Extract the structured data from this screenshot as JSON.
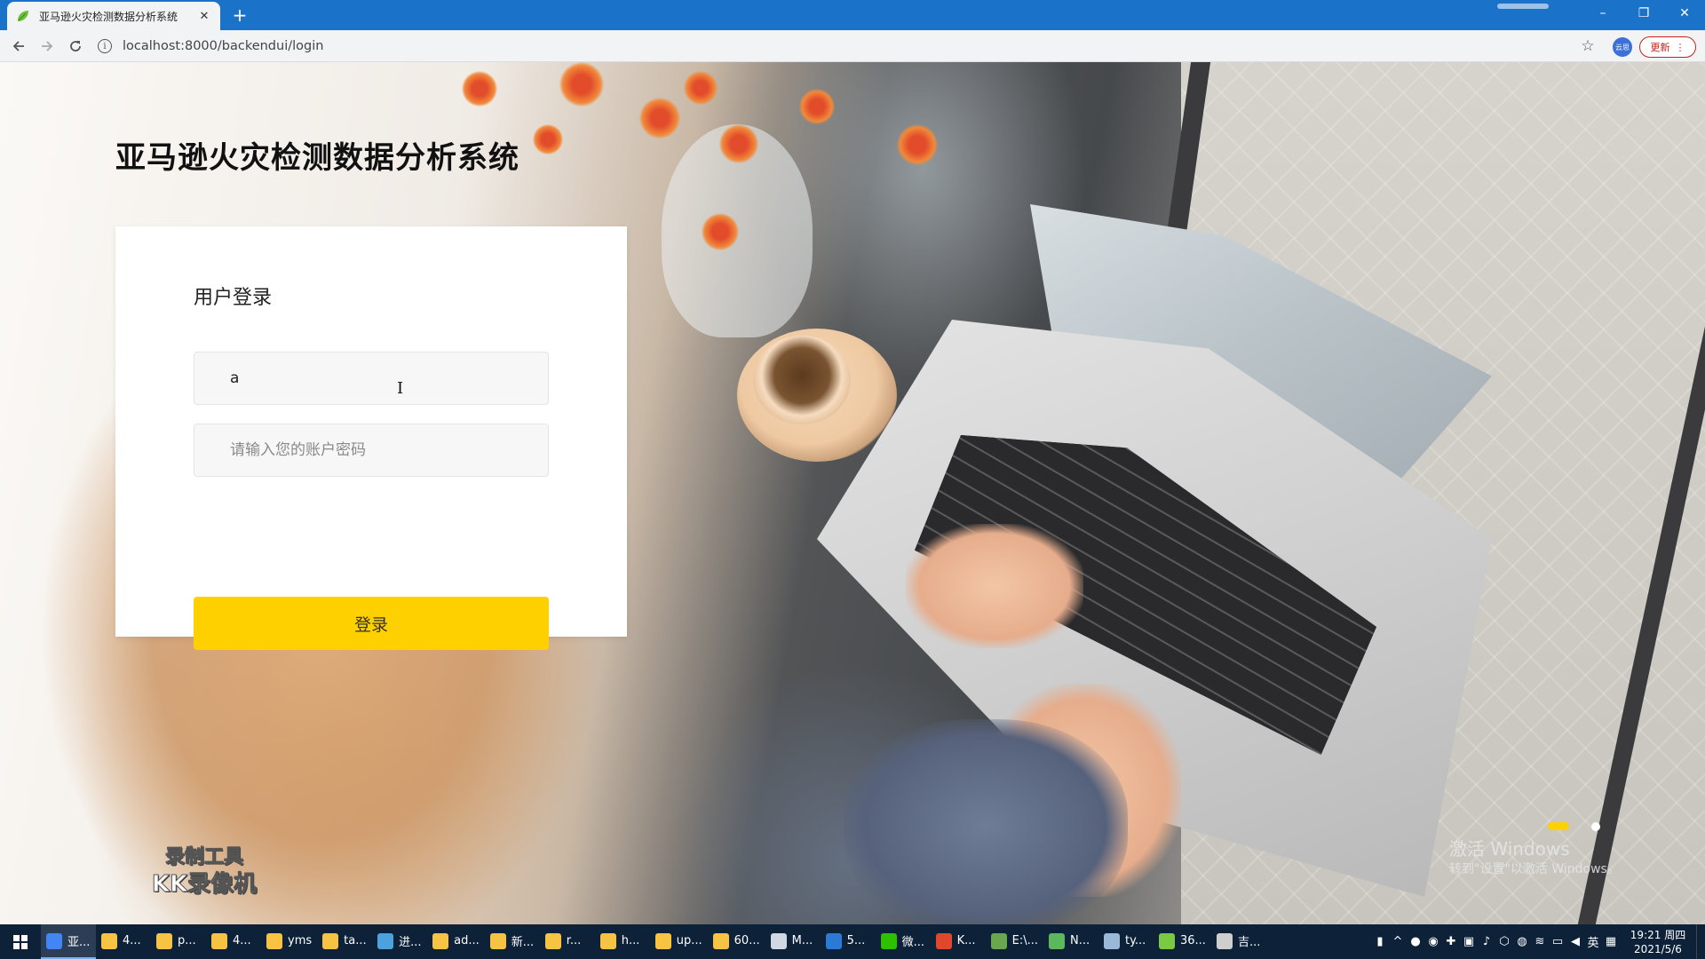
{
  "browser": {
    "tab_title": "亚马逊火灾检测数据分析系统",
    "tab_close": "✕",
    "new_tab": "+",
    "url": "localhost:8000/backendui/login",
    "profile_label": "云思",
    "update_label": "更新",
    "window_controls": {
      "minimize": "–",
      "restore": "❐",
      "close": "✕"
    }
  },
  "page": {
    "site_title": "亚马逊火灾检测数据分析系统",
    "login": {
      "title": "用户登录",
      "username_value": "a",
      "password_placeholder": "请输入您的账户密码",
      "submit_label": "登录"
    },
    "carousel": {
      "active_index": 0,
      "count": 2
    },
    "watermark": {
      "line1": "录制工具",
      "line2": "KK录像机"
    },
    "activate_windows": {
      "line1": "激活 Windows",
      "line2": "转到\"设置\"以激活 Windows。"
    }
  },
  "taskbar": {
    "items": [
      {
        "label": "亚...",
        "color": "#4285f4",
        "active": true
      },
      {
        "label": "4...",
        "color": "#f6c343"
      },
      {
        "label": "p...",
        "color": "#f6c343"
      },
      {
        "label": "4...",
        "color": "#f6c343"
      },
      {
        "label": "yms",
        "color": "#f6c343"
      },
      {
        "label": "ta...",
        "color": "#f6c343"
      },
      {
        "label": "进...",
        "color": "#4aa3df"
      },
      {
        "label": "ad...",
        "color": "#f6c343"
      },
      {
        "label": "新...",
        "color": "#f6c343"
      },
      {
        "label": "r...",
        "color": "#f6c343"
      },
      {
        "label": "h...",
        "color": "#f6c343"
      },
      {
        "label": "up...",
        "color": "#f6c343"
      },
      {
        "label": "60...",
        "color": "#f6c343"
      },
      {
        "label": "M...",
        "color": "#cfd8e3"
      },
      {
        "label": "5...",
        "color": "#2b7bd6"
      },
      {
        "label": "微...",
        "color": "#2dc100"
      },
      {
        "label": "K...",
        "color": "#e0472b"
      },
      {
        "label": "E:\\...",
        "color": "#6aa84f"
      },
      {
        "label": "N...",
        "color": "#5cb85c"
      },
      {
        "label": "ty...",
        "color": "#9ab8d8"
      },
      {
        "label": "36...",
        "color": "#7ac943"
      },
      {
        "label": "吉...",
        "color": "#cfcfcf"
      }
    ],
    "tray": {
      "ime": "英",
      "time": "19:21 周四",
      "date": "2021/5/6"
    }
  }
}
